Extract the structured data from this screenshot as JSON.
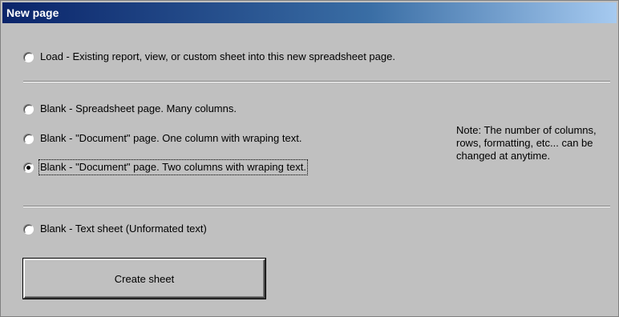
{
  "window": {
    "title": "New page"
  },
  "options": {
    "load": {
      "label": "Load - Existing report, view, or custom sheet into this new spreadsheet page.",
      "checked": false
    },
    "blank_spreadsheet": {
      "label": "Blank - Spreadsheet page.  Many columns.",
      "checked": false
    },
    "blank_document_one": {
      "label": "Blank - \"Document\" page.  One column with wraping text.",
      "checked": false
    },
    "blank_document_two": {
      "label": "Blank - \"Document\" page.  Two columns with wraping text.",
      "checked": true
    },
    "blank_text": {
      "label": "Blank - Text sheet (Unformated text)",
      "checked": false
    }
  },
  "note": {
    "text": "Note: The number of columns, rows, formatting, etc... can be changed at anytime."
  },
  "buttons": {
    "create_label": "Create sheet"
  }
}
